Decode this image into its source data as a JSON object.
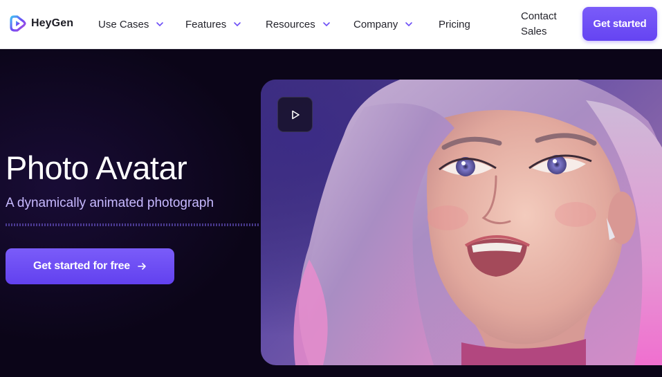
{
  "brand": {
    "name": "HeyGen"
  },
  "nav": {
    "items": [
      {
        "label": "Use Cases",
        "has_dropdown": true
      },
      {
        "label": "Features",
        "has_dropdown": true
      },
      {
        "label": "Resources",
        "has_dropdown": true
      },
      {
        "label": "Company",
        "has_dropdown": true
      },
      {
        "label": "Pricing",
        "has_dropdown": false
      }
    ],
    "contact_label": "Contact Sales",
    "cta_label": "Get started"
  },
  "hero": {
    "title": "Photo Avatar",
    "subtitle": "A dynamically animated photograph",
    "cta_label": "Get started for free",
    "cta_icon": "arrow-right-icon",
    "video": {
      "play_icon": "play-icon"
    }
  },
  "colors": {
    "accent": "#6b4cf6",
    "hero_bg": "#0b0518",
    "subtitle": "#c7b9ff",
    "nav_bg": "#ffffff"
  }
}
